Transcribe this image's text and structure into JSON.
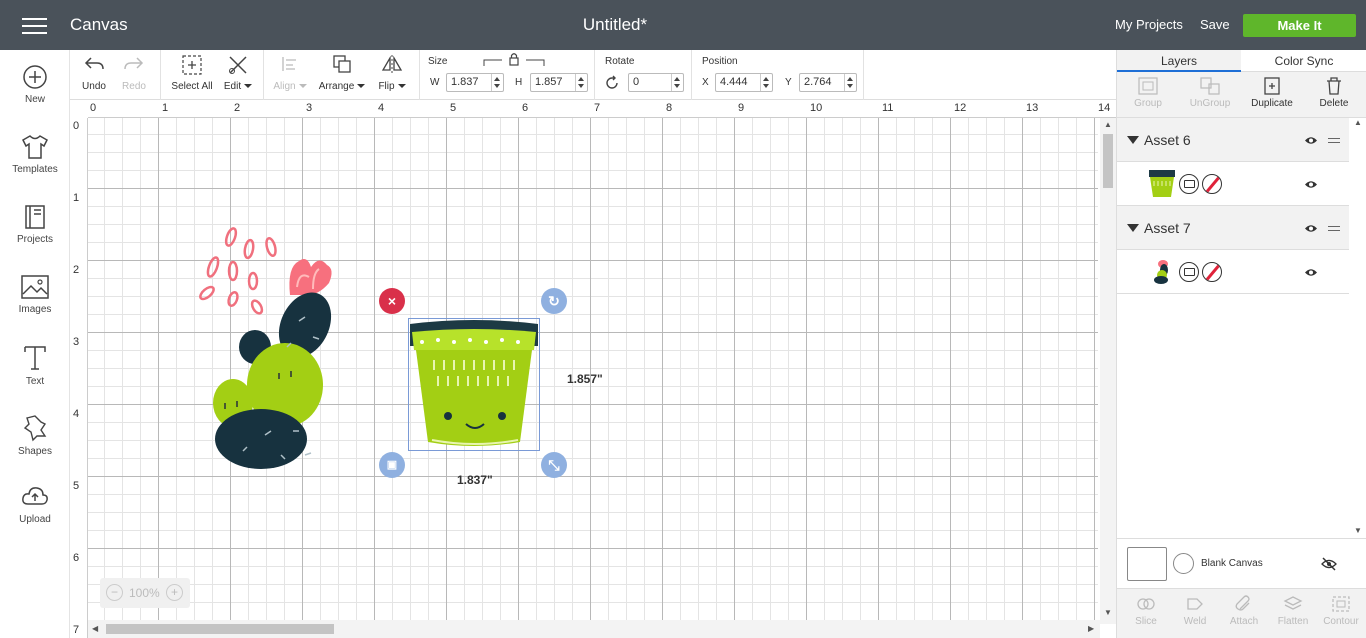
{
  "header": {
    "app_title": "Canvas",
    "doc_title": "Untitled*",
    "my_projects": "My Projects",
    "save": "Save",
    "make_it": "Make It",
    "make_it_color": "#5fb62b"
  },
  "sidebar": {
    "items": [
      {
        "label": "New",
        "icon": "plus-circle-icon"
      },
      {
        "label": "Templates",
        "icon": "shirt-icon"
      },
      {
        "label": "Projects",
        "icon": "book-icon"
      },
      {
        "label": "Images",
        "icon": "image-icon"
      },
      {
        "label": "Text",
        "icon": "text-icon"
      },
      {
        "label": "Shapes",
        "icon": "shapes-icon"
      },
      {
        "label": "Upload",
        "icon": "upload-icon"
      }
    ]
  },
  "toolbar": {
    "undo": "Undo",
    "redo": "Redo",
    "select_all": "Select All",
    "edit": "Edit",
    "align": "Align",
    "arrange": "Arrange",
    "flip": "Flip",
    "size_label": "Size",
    "w_label": "W",
    "w_value": "1.837",
    "h_label": "H",
    "h_value": "1.857",
    "rotate_label": "Rotate",
    "rotate_value": "0",
    "position_label": "Position",
    "x_label": "X",
    "x_value": "4.444",
    "y_label": "Y",
    "y_value": "2.764"
  },
  "canvas": {
    "ruler_top": [
      "0",
      "1",
      "2",
      "3",
      "4",
      "5",
      "6",
      "7",
      "8",
      "9",
      "10",
      "11",
      "12",
      "13",
      "14"
    ],
    "ruler_left": [
      "0",
      "1",
      "2",
      "3",
      "4",
      "5",
      "6",
      "7"
    ],
    "width_dim": "1.837\"",
    "height_dim": "1.857\"",
    "zoom": "100%",
    "zoom_minus": "−",
    "zoom_plus": "+"
  },
  "panel": {
    "tabs": [
      "Layers",
      "Color Sync"
    ],
    "tools": [
      {
        "label": "Group",
        "enabled": false
      },
      {
        "label": "UnGroup",
        "enabled": false
      },
      {
        "label": "Duplicate",
        "enabled": true
      },
      {
        "label": "Delete",
        "enabled": true
      }
    ],
    "assets": [
      {
        "name": "Asset 6"
      },
      {
        "name": "Asset 7"
      }
    ],
    "blank_canvas": "Blank Canvas",
    "bottom_tools": [
      "Slice",
      "Weld",
      "Attach",
      "Flatten",
      "Contour"
    ]
  }
}
